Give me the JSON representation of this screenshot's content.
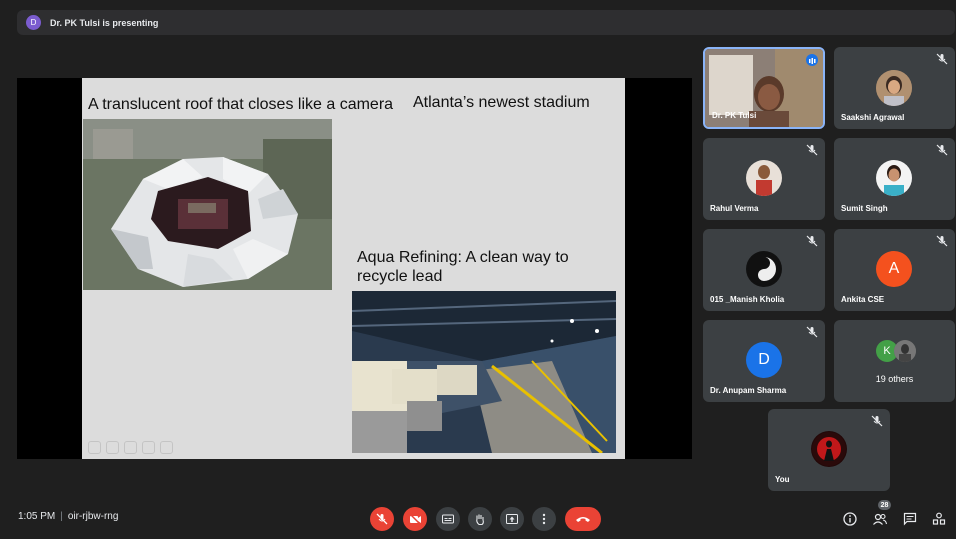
{
  "presenting_bar": {
    "avatar_letter": "D",
    "text": "Dr. PK Tulsi is presenting"
  },
  "slide": {
    "text1": "A translucent roof that closes like a camera",
    "text2": "Atlanta’s newest stadium",
    "text3": "Aqua Refining: A clean way to recycle lead"
  },
  "participants": [
    {
      "name": "Dr. PK Tulsi",
      "speaking": true
    },
    {
      "name": "Saakshi Agrawal",
      "muted": true
    },
    {
      "name": "Rahul Verma",
      "muted": true
    },
    {
      "name": "Sumit Singh",
      "muted": true
    },
    {
      "name": "015 _Manish Kholia",
      "muted": true
    },
    {
      "name": "Ankita CSE",
      "avatar_letter": "A",
      "avatar_color": "#f4511e",
      "muted": true
    },
    {
      "name": "Dr. Anupam Sharma",
      "avatar_letter": "D",
      "avatar_color": "#1a73e8",
      "muted": true
    },
    {
      "others_label": "19 others",
      "avatar_letter": "K",
      "avatar_color": "#43a047"
    },
    {
      "name": "You",
      "muted": true
    }
  ],
  "meeting": {
    "time": "1:05 PM",
    "code": "oir-rjbw-rng"
  },
  "controls": {
    "mic": "mic-off-icon",
    "camera": "camera-off-icon",
    "captions": "captions-icon",
    "hand": "raise-hand-icon",
    "present": "present-icon",
    "more": "more-options-icon",
    "end": "end-call-icon"
  },
  "right_controls": {
    "people_count": "28"
  },
  "colors": {
    "end_call": "#ea4335",
    "muted": "#ea4335",
    "background": "#1f1f1f",
    "tile": "#3c4043"
  }
}
